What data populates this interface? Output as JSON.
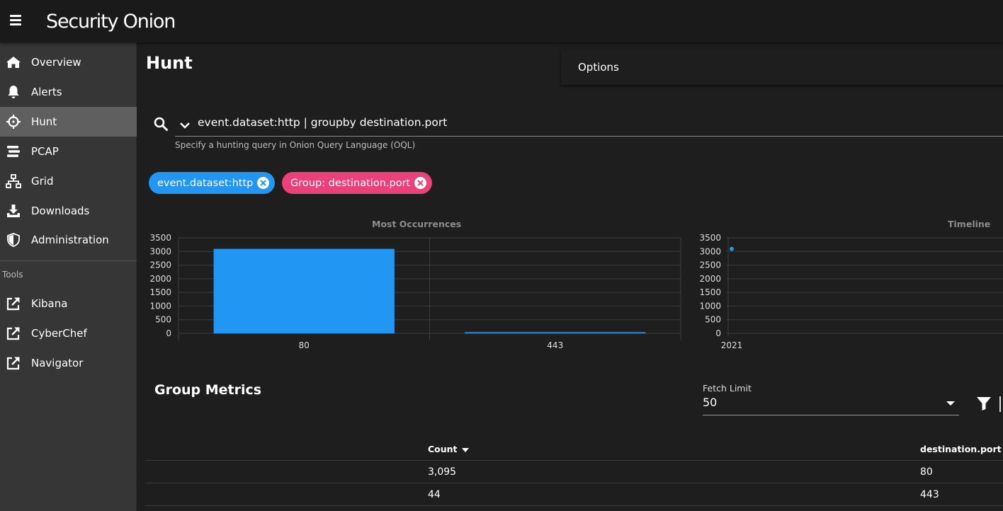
{
  "header": {
    "logo_text": "Security Onion"
  },
  "sidebar": {
    "items": [
      {
        "label": "Overview",
        "icon": "home-icon"
      },
      {
        "label": "Alerts",
        "icon": "bell-icon"
      },
      {
        "label": "Hunt",
        "icon": "crosshairs-icon",
        "active": true
      },
      {
        "label": "PCAP",
        "icon": "stream-icon"
      },
      {
        "label": "Grid",
        "icon": "sitemap-icon"
      },
      {
        "label": "Downloads",
        "icon": "download-icon"
      },
      {
        "label": "Administration",
        "icon": "shield-icon"
      }
    ],
    "tools_label": "Tools",
    "tools": [
      {
        "label": "Kibana",
        "icon": "external-link-icon"
      },
      {
        "label": "CyberChef",
        "icon": "external-link-icon"
      },
      {
        "label": "Navigator",
        "icon": "external-link-icon"
      }
    ]
  },
  "main": {
    "title": "Hunt",
    "options_label": "Options",
    "query": "event.dataset:http | groupby destination.port",
    "query_hint": "Specify a hunting query in Onion Query Language (OQL)",
    "chips": [
      {
        "label": "event.dataset:http",
        "color": "#2196f3"
      },
      {
        "label": "Group: destination.port",
        "color": "#ec407a"
      }
    ],
    "group_metrics_title": "Group Metrics",
    "fetch_limit": {
      "label": "Fetch Limit",
      "value": "50"
    },
    "table": {
      "headers": [
        "Count",
        "destination.port"
      ],
      "rows": [
        [
          "3,095",
          "80"
        ],
        [
          "44",
          "443"
        ]
      ]
    }
  },
  "chart_data": [
    {
      "type": "bar",
      "title": "Most Occurrences",
      "categories": [
        "80",
        "443"
      ],
      "values": [
        3095,
        44
      ],
      "ylim": [
        0,
        3500
      ],
      "yticks": [
        0,
        500,
        1000,
        1500,
        2000,
        2500,
        3000,
        3500
      ],
      "grid": true,
      "color": "#2196f3"
    },
    {
      "type": "line",
      "title": "Timeline",
      "x": [
        "2021"
      ],
      "y": [
        3095
      ],
      "ylim": [
        0,
        3500
      ],
      "yticks": [
        0,
        500,
        1000,
        1500,
        2000,
        2500,
        3000,
        3500
      ],
      "grid": true,
      "color": "#2196f3"
    }
  ]
}
